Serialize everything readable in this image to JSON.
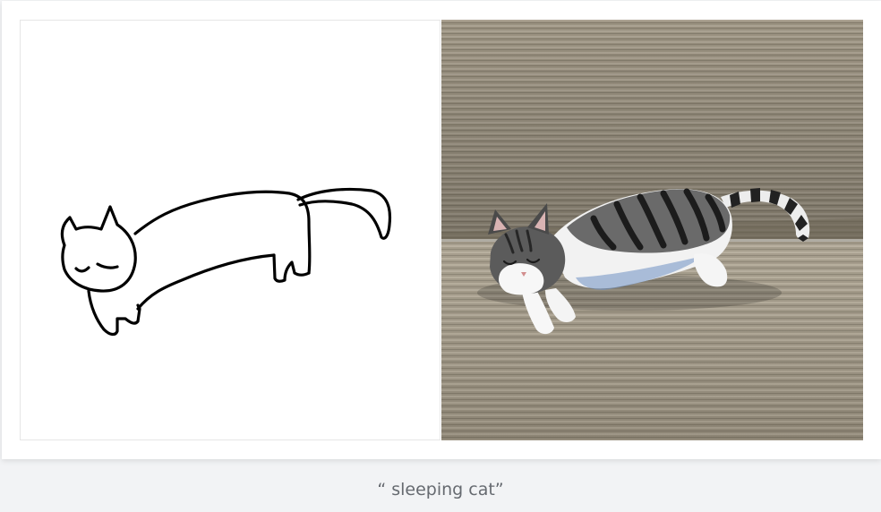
{
  "caption": {
    "text": "“ sleeping cat”"
  },
  "sketch": {
    "icon": "cat-sketch",
    "stroke_color": "#000000",
    "background": "#ffffff"
  },
  "photo": {
    "icon": "cat-photo",
    "couch_color": "#a8a08f",
    "cat_colors": [
      "#ffffff",
      "#5a5a5a",
      "#1e1e1e"
    ]
  }
}
